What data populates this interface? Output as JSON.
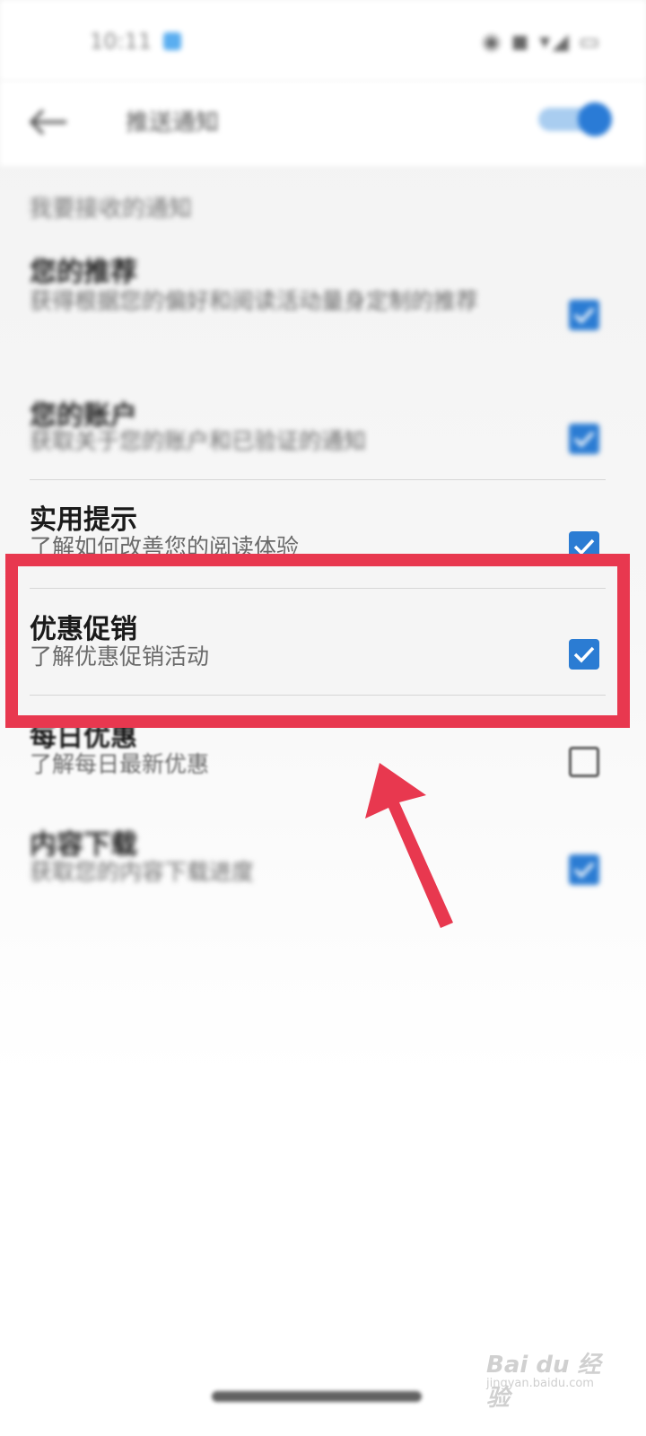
{
  "statusbar": {
    "time": "10:11",
    "icons": "◉ ◼ ▾◢ ▭"
  },
  "appbar": {
    "title": "推送通知",
    "back_icon": "back-arrow-icon",
    "toggle_on": true
  },
  "section_header": "我要接收的通知",
  "items": [
    {
      "title": "您的推荐",
      "desc": "获得根据您的偏好和阅读活动量身定制的推荐",
      "checked": true
    },
    {
      "title": "您的账户",
      "desc": "获取关于您的账户和已验证的通知",
      "checked": true
    },
    {
      "title": "实用提示",
      "desc": "了解如何改善您的阅读体验",
      "checked": true
    },
    {
      "title": "优惠促销",
      "desc": "了解优惠促销活动",
      "checked": true
    },
    {
      "title": "每日优惠",
      "desc": "了解每日最新优惠",
      "checked": false
    },
    {
      "title": "内容下载",
      "desc": "获取您的内容下载进度",
      "checked": true
    }
  ],
  "watermark": {
    "brand": "Bai du 经验",
    "url": "jingyan.baidu.com"
  },
  "colors": {
    "accent": "#2b7cd3",
    "highlight": "#e8384f"
  }
}
